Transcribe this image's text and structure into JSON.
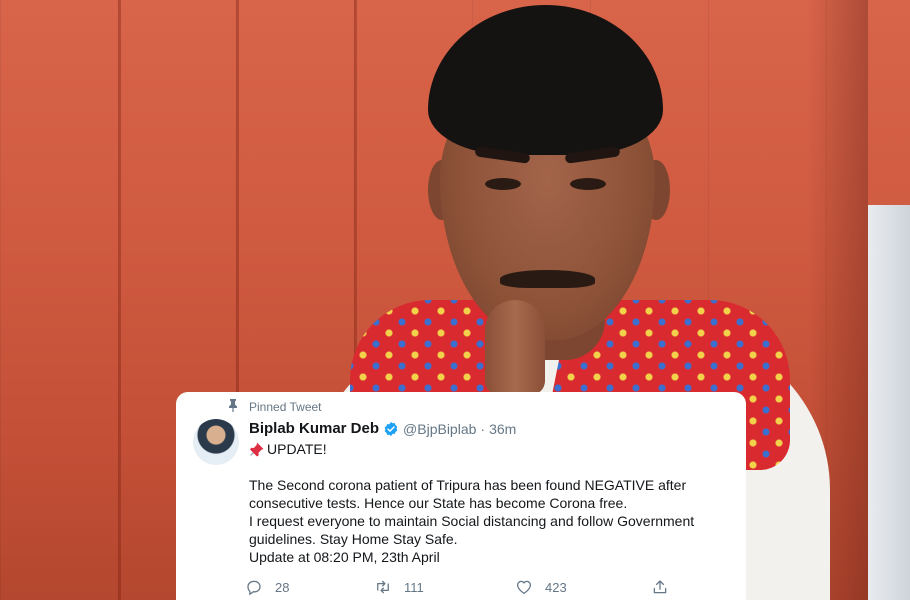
{
  "tweet": {
    "pinned_label": "Pinned Tweet",
    "author_name": "Biplab Kumar Deb",
    "handle": "@BjpBiplab",
    "separator": "·",
    "time": "36m",
    "headline": "UPDATE!",
    "lines": [
      "The Second corona patient of Tripura has been found NEGATIVE after",
      "consecutive tests. Hence our State has become Corona free.",
      "I request everyone to maintain Social distancing and follow Government",
      "guidelines.  Stay Home Stay Safe."
    ],
    "footer": "Update at 08:20 PM, 23th April",
    "replies": "28",
    "retweets": "111",
    "likes": "423"
  },
  "icons": {
    "pin": "pin-icon",
    "verified": "verified-badge-icon",
    "pushpin": "pushpin-emoji-icon",
    "reply": "reply-icon",
    "retweet": "retweet-icon",
    "like": "heart-icon",
    "share": "share-icon"
  },
  "colors": {
    "verified_blue": "#1da1f2",
    "muted_text": "#657786",
    "text": "#14171a",
    "pushpin_red": "#dd2e44",
    "background_wall": "#cf5a40"
  }
}
